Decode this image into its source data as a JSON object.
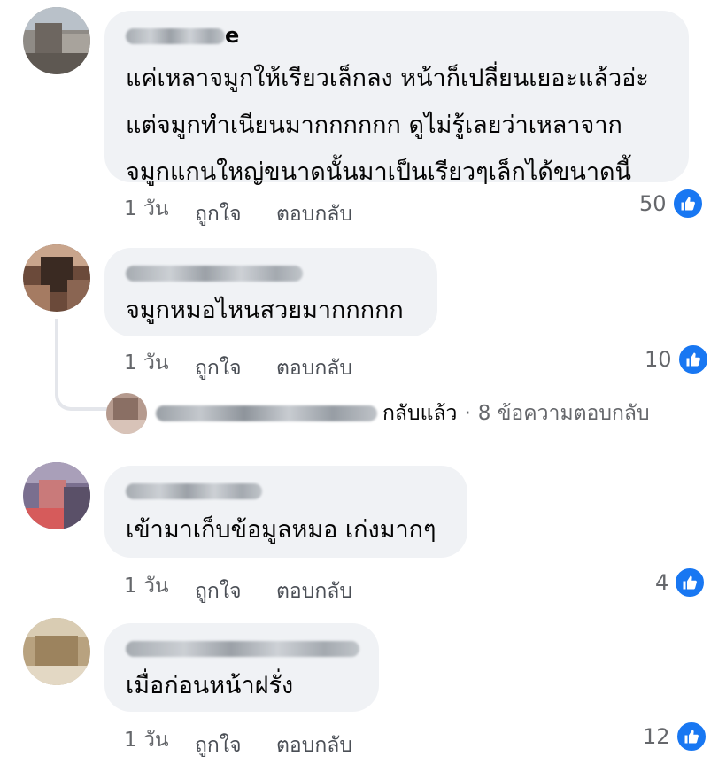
{
  "comments": [
    {
      "author_suffix": "e",
      "lines": [
        "แค่เหลาจมูกให้เรียวเล็กลง หน้าก็เปลี่ยนเยอะแล้วอ่ะ",
        "แต่จมูกทำเนียนมากกกกกก ดูไม่รู้เลยว่าเหลาจาก",
        "จมูกแกนใหญ่ขนาดนั้นมาเป็นเรียวๆเล็กได้ขนาดนี้"
      ],
      "time": "1 วัน",
      "like_label": "ถูกใจ",
      "reply_label": "ตอบกลับ",
      "like_count": "50"
    },
    {
      "author_suffix": "",
      "lines": [
        "จมูกหมอไหนสวยมากกกกก"
      ],
      "time": "1 วัน",
      "like_label": "ถูกใจ",
      "reply_label": "ตอบกลับ",
      "like_count": "10"
    },
    {
      "author_suffix": "",
      "lines": [
        "เข้ามาเก็บข้อมูลหมอ เก่งมากๆ"
      ],
      "time": "1 วัน",
      "like_label": "ถูกใจ",
      "reply_label": "ตอบกลับ",
      "like_count": "4"
    },
    {
      "author_suffix": "",
      "lines": [
        "เมื่อก่อนหน้าฝรั่ง"
      ],
      "time": "1 วัน",
      "like_label": "ถูกใจ",
      "reply_label": "ตอบกลับ",
      "like_count": "12"
    }
  ],
  "replies_summary": {
    "replied_text": "กลับแล้ว",
    "separator": "·",
    "count_text": "8 ข้อความตอบกลับ"
  },
  "icons": {
    "like": "thumbs-up-icon"
  },
  "colors": {
    "bubble": "#f0f2f5",
    "like_blue": "#1877f2"
  }
}
